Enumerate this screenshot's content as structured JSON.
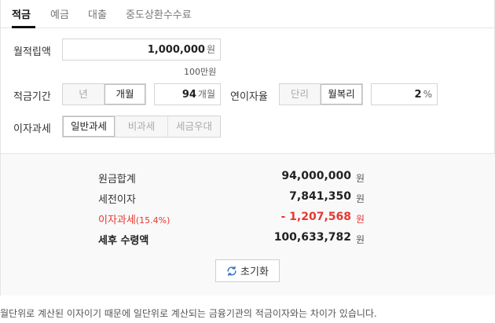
{
  "tabs": [
    {
      "label": "적금",
      "active": true
    },
    {
      "label": "예금",
      "active": false
    },
    {
      "label": "대출",
      "active": false
    },
    {
      "label": "중도상환수수료",
      "active": false
    }
  ],
  "form": {
    "monthly_label": "월적립액",
    "monthly_value": "1,000,000",
    "monthly_unit": "원",
    "monthly_hint": "100만원",
    "period_label": "적금기간",
    "period_options": [
      "년",
      "개월"
    ],
    "period_selected": "개월",
    "period_value": "94",
    "period_unit": "개월",
    "rate_label": "연이자율",
    "rate_options": [
      "단리",
      "월복리"
    ],
    "rate_selected": "월복리",
    "rate_value": "2",
    "rate_unit": "%",
    "tax_label": "이자과세",
    "tax_options": [
      "일반과세",
      "비과세",
      "세금우대"
    ],
    "tax_selected": "일반과세"
  },
  "result": {
    "principal_label": "원금합계",
    "principal_value": "94,000,000",
    "pretax_label": "세전이자",
    "pretax_value": "7,841,350",
    "tax_label_main": "이자과세",
    "tax_label_rate": "(15.4%)",
    "tax_value": "- 1,207,568",
    "net_label": "세후 수령액",
    "net_value": "100,633,782",
    "unit": "원"
  },
  "reset_label": "초기화",
  "footnote": "월단위로 계산된 이자이기 때문에 일단위로 계산되는 금융기관의 적금이자와는 차이가 있습니다.",
  "colors": {
    "accent_red": "#e8372f",
    "refresh_icon": "#2f6fc4"
  }
}
